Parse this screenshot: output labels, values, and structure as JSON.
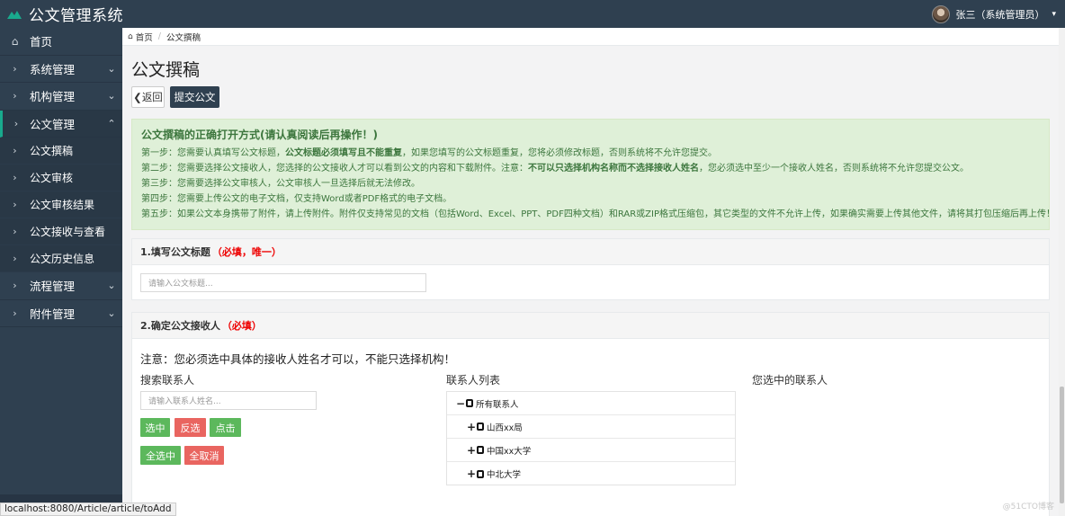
{
  "app": {
    "title": "公文管理系统"
  },
  "user": {
    "name": "张三（系统管理员）"
  },
  "sidebar": {
    "items": [
      {
        "label": "首页",
        "icon": "home-icon"
      },
      {
        "label": "系统管理",
        "icon": "chevron-right-icon"
      },
      {
        "label": "机构管理",
        "icon": "chevron-right-icon"
      },
      {
        "label": "公文管理",
        "icon": "chevron-right-icon",
        "active": true
      }
    ],
    "subitems": [
      "公文撰稿",
      "公文审核",
      "公文审核结果",
      "公文接收与查看",
      "公文历史信息"
    ],
    "items_after": [
      "流程管理",
      "附件管理"
    ]
  },
  "breadcrumb": {
    "home": "首页",
    "current": "公文撰稿"
  },
  "page": {
    "title": "公文撰稿",
    "back_label": "返回",
    "submit_label": "提交公文"
  },
  "notice": {
    "title": "公文撰稿的正确打开方式(请认真阅读后再操作！)",
    "step1_a": "第一步：您需要认真填写公文标题，",
    "step1_b": "公文标题必须填写且不能重复",
    "step1_c": "，如果您填写的公文标题重复，您将必须修改标题，否则系统将不允许您提交。",
    "step2_a": "第二步：您需要选择公文接收人，您选择的公文接收人才可以看到公文的内容和下载附件。注意：",
    "step2_b": "不可以只选择机构名称而不选择接收人姓名",
    "step2_c": "，您必须选中至少一个接收人姓名，否则系统将不允许您提交公文。",
    "step3": "第三步：您需要选择公文审核人，公文审核人一旦选择后就无法修改。",
    "step4": "第四步：您需要上传公文的电子文档，仅支持Word或者PDF格式的电子文档。",
    "step5": "第五步：如果公文本身携带了附件，请上传附件。附件仅支持常见的文档（包括Word、Excel、PPT、PDF四种文档）和RAR或ZIP格式压缩包，其它类型的文件不允许上传，如果确实需要上传其他文件，请将其打包压缩后再上传！"
  },
  "section1": {
    "heading": "1.填写公文标题",
    "required": "（必填，唯一）",
    "placeholder": "请输入公文标题..."
  },
  "section2": {
    "heading": "2.确定公文接收人",
    "required": "（必填）",
    "note": "注意：您必须选中具体的接收人姓名才可以，不能只选择机构！",
    "search_title": "搜索联系人",
    "search_placeholder": "请输入联系人姓名...",
    "list_title": "联系人列表",
    "selected_title": "您选中的联系人",
    "btn_select": "选中",
    "btn_invert": "反选",
    "btn_click": "点击",
    "btn_select_all": "全选中",
    "btn_cancel_all": "全取消",
    "tree": [
      {
        "toggle": "−",
        "label": "所有联系人"
      },
      {
        "toggle": "+",
        "label": "山西xx局"
      },
      {
        "toggle": "+",
        "label": "中国xx大学"
      },
      {
        "toggle": "+",
        "label": "中北大学"
      }
    ]
  },
  "status_url": "localhost:8080/Article/article/toAdd",
  "watermark": "@51CTO博客",
  "colors": {
    "sidebar": "#2f4050",
    "accent": "#19aa8d",
    "notice_bg": "#dff0d8",
    "success": "#5cb85c",
    "danger": "#e96560",
    "required": "#e00000"
  }
}
